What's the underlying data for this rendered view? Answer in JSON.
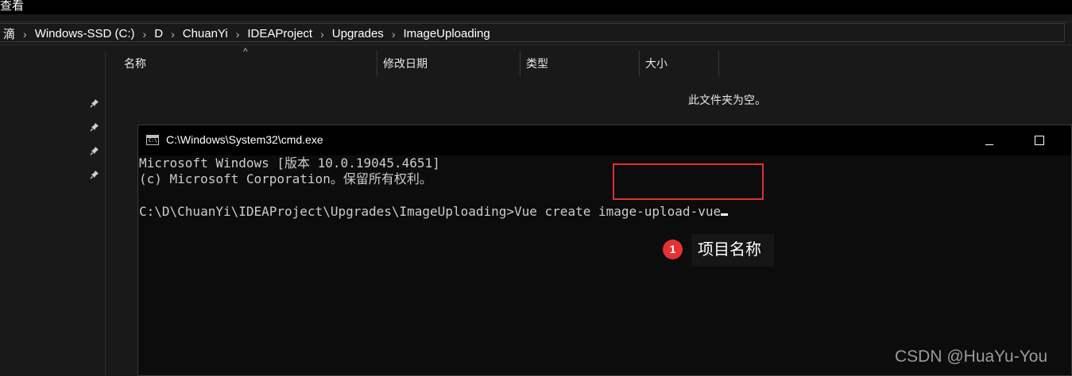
{
  "menu": {
    "label": "查看"
  },
  "address": {
    "crumbs": [
      "滴",
      "Windows-SSD (C:)",
      "D",
      "ChuanYi",
      "IDEAProject",
      "Upgrades",
      "ImageUploading"
    ],
    "separator": "›"
  },
  "columns": {
    "name": "名称",
    "modified": "修改日期",
    "type": "类型",
    "size": "大小"
  },
  "content": {
    "empty_message": "此文件夹为空。"
  },
  "cmd": {
    "title": "C:\\Windows\\System32\\cmd.exe",
    "icon_text": "C:\\.",
    "line1": "Microsoft Windows [版本 10.0.19045.4651]",
    "line2": "(c) Microsoft Corporation。保留所有权利。",
    "prompt": "C:\\D\\ChuanYi\\IDEAProject\\Upgrades\\ImageUploading>Vue create ",
    "typed_project": "image-upload-vue"
  },
  "annotation": {
    "step_number": "1",
    "step_label": "项目名称",
    "highlight_color": "#e0302f"
  },
  "watermark": "CSDN @HuaYu-You",
  "icons": {
    "pins": [
      "pin-icon",
      "pin-icon",
      "pin-icon",
      "pin-icon"
    ],
    "cmd": "cmd-app-icon",
    "minimize": "minimize-icon",
    "maximize": "maximize-icon"
  }
}
